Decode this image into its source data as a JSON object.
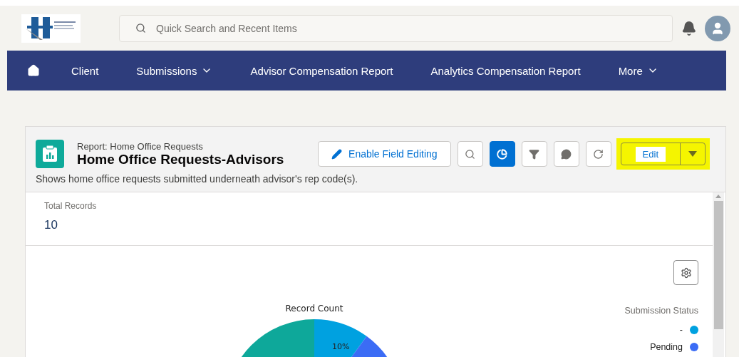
{
  "header": {
    "search": {
      "placeholder": "Quick Search and Recent Items"
    }
  },
  "nav": {
    "items": [
      {
        "label": "Client",
        "has_menu": false
      },
      {
        "label": "Submissions",
        "has_menu": true
      },
      {
        "label": "Advisor Compensation Report",
        "has_menu": false
      },
      {
        "label": "Analytics Compensation Report",
        "has_menu": false
      },
      {
        "label": "More",
        "has_menu": true
      }
    ]
  },
  "report": {
    "type_label": "Report: Home Office Requests",
    "title": "Home Office Requests-Advisors",
    "description": "Shows home office requests submitted underneath advisor's rep code(s).",
    "field_editing": "Enable Field Editing",
    "tools": [
      {
        "kind": "search",
        "selected": false
      },
      {
        "kind": "chart",
        "selected": true
      },
      {
        "kind": "filter",
        "selected": false
      },
      {
        "kind": "comments",
        "selected": false
      },
      {
        "kind": "refresh",
        "selected": false
      }
    ],
    "edit": {
      "label": "Edit",
      "highlighted": true
    }
  },
  "summary": {
    "label": "Total Records",
    "value": "10"
  },
  "chart": {
    "title": "Record Count",
    "slice_label": "10%",
    "legend_title": "Submission Status",
    "legend": [
      {
        "label": "-",
        "color": "#00a1e0"
      },
      {
        "label": "Pending",
        "color": "#3b6cf5"
      }
    ]
  }
}
